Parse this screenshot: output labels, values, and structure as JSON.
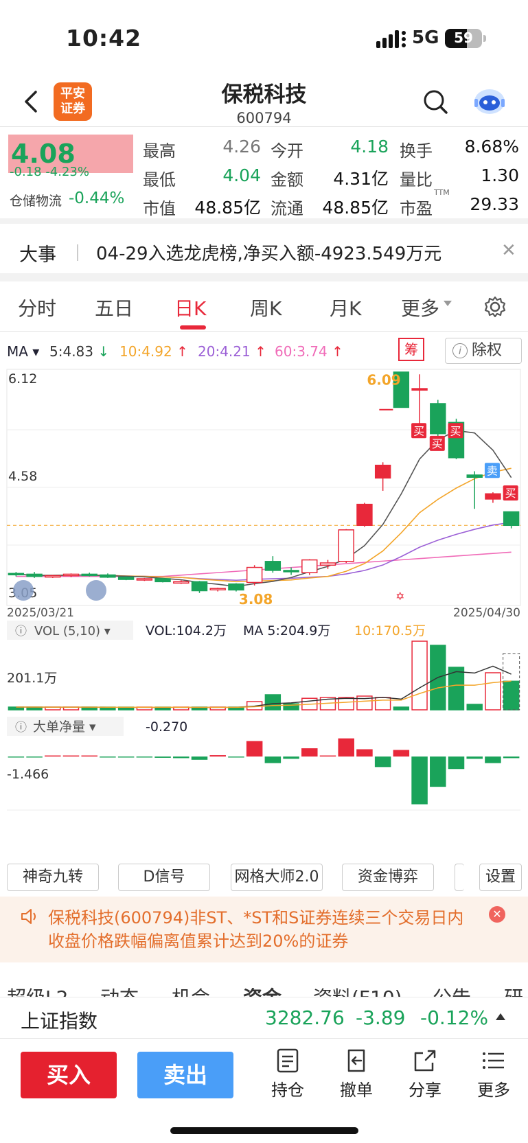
{
  "status": {
    "time": "10:42",
    "network": "5G",
    "battery": "59",
    "battery_level": 0.59
  },
  "header": {
    "title": "保税科技",
    "code": "600794",
    "logo": "平安证券"
  },
  "quote": {
    "price": "4.08",
    "change": "-0.18",
    "pct": "-4.23%",
    "sector_name": "仓储物流",
    "sector_pct": "-0.44%",
    "rows": [
      [
        {
          "l": "最高",
          "v": "4.26",
          "c": "gray"
        },
        {
          "l": "今开",
          "v": "4.18",
          "c": "green"
        },
        {
          "l": "换手",
          "v": "8.68%",
          "c": "black"
        }
      ],
      [
        {
          "l": "最低",
          "v": "4.04",
          "c": "green"
        },
        {
          "l": "金额",
          "v": "4.31亿",
          "c": "black"
        },
        {
          "l": "量比",
          "v": "1.30",
          "c": "black"
        }
      ],
      [
        {
          "l": "市值",
          "v": "48.85亿",
          "c": "black"
        },
        {
          "l": "流通",
          "v": "48.85亿",
          "c": "black"
        },
        {
          "l": "市盈",
          "v": "29.33",
          "c": "black",
          "sup": "TTM"
        }
      ]
    ]
  },
  "event": {
    "label": "大事",
    "text": "04-29入选龙虎榜,净买入额-4923.549万元"
  },
  "tabs": [
    "分时",
    "五日",
    "日K",
    "周K",
    "月K",
    "更多"
  ],
  "active_tab": "日K",
  "ma": {
    "label": "MA",
    "ma5": "5:4.83",
    "ma10": "10:4.92",
    "ma20": "20:4.21",
    "ma60": "60:3.74"
  },
  "chou_label": "筹",
  "chuquan_label": "除权",
  "chart": {
    "price_high": "6.12",
    "price_mid": "4.58",
    "price_low": "3.05",
    "max_label": "6.09",
    "min_label": "3.08",
    "date_start": "2025/03/21",
    "date_end": "2025/04/30",
    "signals": [
      "买",
      "买",
      "买",
      "卖",
      "买"
    ]
  },
  "chart_data": [
    {
      "type": "candlestick",
      "title": "日K",
      "x": [
        "1",
        "2",
        "3",
        "4",
        "5",
        "6",
        "7",
        "8",
        "9",
        "10",
        "11",
        "12",
        "13",
        "14",
        "15",
        "16",
        "17",
        "18",
        "19",
        "20",
        "21",
        "22",
        "23",
        "24",
        "25",
        "26",
        "27",
        "28"
      ],
      "ohlc": [
        [
          3.44,
          3.46,
          3.4,
          3.43
        ],
        [
          3.43,
          3.46,
          3.38,
          3.4
        ],
        [
          3.4,
          3.42,
          3.38,
          3.41
        ],
        [
          3.41,
          3.44,
          3.39,
          3.43
        ],
        [
          3.43,
          3.45,
          3.4,
          3.42
        ],
        [
          3.42,
          3.44,
          3.38,
          3.39
        ],
        [
          3.39,
          3.4,
          3.35,
          3.36
        ],
        [
          3.36,
          3.38,
          3.34,
          3.37
        ],
        [
          3.37,
          3.38,
          3.32,
          3.33
        ],
        [
          3.33,
          3.35,
          3.3,
          3.33
        ],
        [
          3.33,
          3.34,
          3.18,
          3.21
        ],
        [
          3.23,
          3.25,
          3.2,
          3.24
        ],
        [
          3.3,
          3.31,
          3.2,
          3.22
        ],
        [
          3.32,
          3.55,
          3.28,
          3.52
        ],
        [
          3.6,
          3.67,
          3.45,
          3.48
        ],
        [
          3.48,
          3.52,
          3.42,
          3.47
        ],
        [
          3.45,
          3.63,
          3.42,
          3.62
        ],
        [
          3.55,
          3.62,
          3.5,
          3.58
        ],
        [
          3.6,
          4.03,
          3.58,
          4.02
        ],
        [
          4.08,
          4.38,
          4.06,
          4.36
        ],
        [
          4.71,
          4.92,
          4.54,
          4.88
        ],
        [
          6.12,
          6.12,
          5.88,
          5.65
        ],
        [
          5.88,
          6.09,
          5.4,
          5.9
        ],
        [
          5.7,
          5.75,
          5.2,
          5.3
        ],
        [
          5.45,
          5.5,
          4.96,
          4.98
        ],
        [
          4.75,
          4.8,
          4.3,
          4.72
        ],
        [
          4.43,
          4.52,
          4.38,
          4.5
        ],
        [
          4.26,
          4.26,
          4.04,
          4.08
        ]
      ],
      "ylim": [
        3.05,
        6.12
      ]
    },
    {
      "type": "bar",
      "title": "VOL(5,10)",
      "series_summary": {
        "vol": "VOL:104.2万",
        "ma5": "5:204.9万",
        "ma10": "10:170.5万",
        "axis": "201.1万"
      },
      "values": [
        10,
        10,
        9,
        10,
        9,
        9,
        8,
        9,
        9,
        10,
        8,
        9,
        10,
        30,
        55,
        22,
        42,
        45,
        45,
        50,
        45,
        10,
        250,
        235,
        155,
        20,
        135,
        104.2
      ]
    },
    {
      "type": "bar",
      "title": "大单净量",
      "series_summary": {
        "value": "-0.270",
        "axis": "-1.466"
      },
      "values": [
        -0.02,
        -0.02,
        0.01,
        0.01,
        0.01,
        -0.02,
        -0.03,
        -0.03,
        -0.04,
        -0.05,
        -0.1,
        0.04,
        -0.02,
        0.47,
        -0.2,
        -0.07,
        0.25,
        0.01,
        0.55,
        0.22,
        -0.32,
        0.2,
        -1.45,
        -0.92,
        -0.38,
        -0.07,
        -0.2,
        -0.05
      ]
    }
  ],
  "vol_label": "VOL",
  "vol_params": "(5,10)",
  "dadan_label": "大单净量",
  "indicators": [
    "神奇九转",
    "D信号",
    "网格大师2.0",
    "资金博弈",
    "设置"
  ],
  "notice": "保税科技(600794)非ST、*ST和S证券连续三个交易日内收盘价格跌幅偏离值累计达到20%的证券",
  "subtabs": [
    "超级L2",
    "动态",
    "机会",
    "资金",
    "资料(F10)",
    "公告",
    "研报"
  ],
  "index": {
    "name": "上证指数",
    "value": "3282.76",
    "change": "-3.89",
    "pct": "-0.12%"
  },
  "bottom": {
    "buy": "买入",
    "sell": "卖出",
    "actions": [
      "持仓",
      "撤单",
      "分享",
      "更多"
    ]
  }
}
